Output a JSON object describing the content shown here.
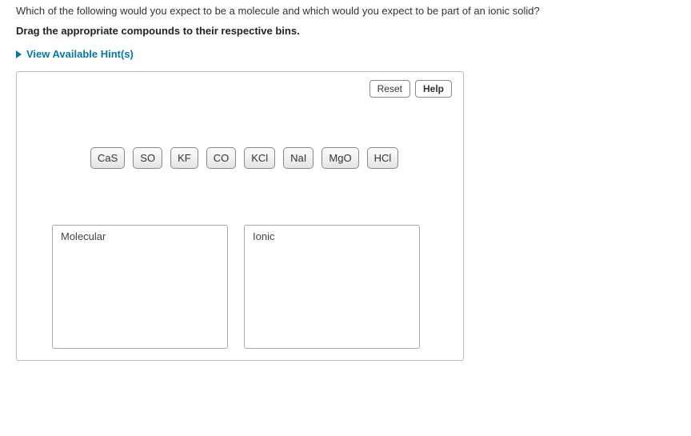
{
  "question": "Which of the following would you expect to be a molecule and which would you expect to be part of an ionic solid?",
  "instruction": "Drag the appropriate compounds to their respective bins.",
  "hints_label": "View Available Hint(s)",
  "controls": {
    "reset": "Reset",
    "help": "Help"
  },
  "compounds": [
    "CaS",
    "SO",
    "KF",
    "CO",
    "KCl",
    "NaI",
    "MgO",
    "HCl"
  ],
  "bins": {
    "molecular": "Molecular",
    "ionic": "Ionic"
  }
}
